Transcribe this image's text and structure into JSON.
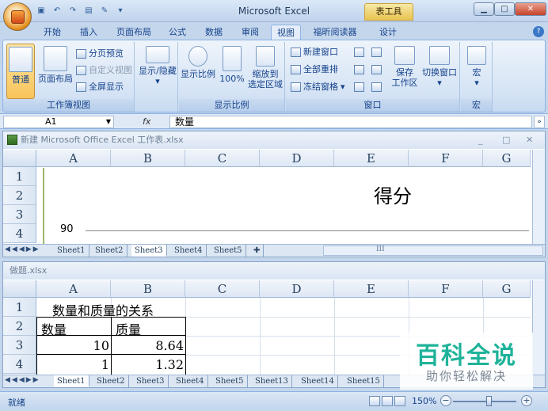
{
  "window": {
    "title": "Microsoft Excel",
    "context_tab": "表工具",
    "min": "▁",
    "max": "□",
    "close": "✕"
  },
  "quick_access": [
    "▣",
    "↶",
    "↷",
    "▤",
    "✎",
    "▾"
  ],
  "tabs": [
    {
      "label": "开始",
      "active": false
    },
    {
      "label": "插入",
      "active": false
    },
    {
      "label": "页面布局",
      "active": false
    },
    {
      "label": "公式",
      "active": false
    },
    {
      "label": "数据",
      "active": false
    },
    {
      "label": "审阅",
      "active": false
    },
    {
      "label": "视图",
      "active": true
    },
    {
      "label": "福昕阅读器",
      "active": false
    },
    {
      "label": "设计",
      "active": false
    }
  ],
  "ribbon": {
    "workbook_views": {
      "label": "工作簿视图",
      "normal": "普通",
      "page_layout": "页面布局",
      "page_break": "分页预览",
      "custom": "自定义视图",
      "fullscreen": "全屏显示"
    },
    "show_hide": {
      "label": "显示/隐藏"
    },
    "zoom": {
      "label": "显示比例",
      "zoom_btn": "显示比例",
      "hundred": "100%",
      "to_selection_1": "缩放到",
      "to_selection_2": "选定区域"
    },
    "window": {
      "label": "窗口",
      "new_window": "新建窗口",
      "arrange_all": "全部重排",
      "freeze": "冻结窗格",
      "save_ws_1": "保存",
      "save_ws_2": "工作区",
      "switch": "切换窗口"
    },
    "macros": {
      "label": "宏",
      "btn": "宏"
    }
  },
  "formula_bar": {
    "name_box": "A1",
    "fx": "fx",
    "content": "数量"
  },
  "workbook1": {
    "title": "新建 Microsoft Office Excel 工作表.xlsx",
    "columns": [
      "A",
      "B",
      "C",
      "D",
      "E",
      "F",
      "G"
    ],
    "rows": [
      "1",
      "2",
      "3",
      "4"
    ],
    "chart_title": "得分",
    "axis_value": "90",
    "sheets": [
      "Sheet1",
      "Sheet2",
      "Sheet3",
      "Sheet4",
      "Sheet5"
    ],
    "active_sheet": "Sheet3",
    "scroll_mark": "III"
  },
  "workbook2": {
    "title": "做题.xlsx",
    "columns": [
      "A",
      "B",
      "C",
      "D",
      "E",
      "F",
      "G"
    ],
    "rows": [
      "1",
      "2",
      "3",
      "4"
    ],
    "cells": {
      "a1": "数量和质量的关系",
      "a2": "数量",
      "b2": "质量",
      "a3": "10",
      "b3": "8.64",
      "a4": "1",
      "b4": "1.32"
    },
    "sheets": [
      "Sheet1",
      "Sheet2",
      "Sheet3",
      "Sheet4",
      "Sheet5",
      "Sheet13",
      "Sheet14",
      "Sheet15"
    ],
    "active_sheet": "Sheet1"
  },
  "status": {
    "ready": "就绪",
    "zoom": "150%",
    "minus": "−",
    "plus": "+"
  },
  "watermark": {
    "line1": "百科全说",
    "line2": "助你轻松解决"
  }
}
